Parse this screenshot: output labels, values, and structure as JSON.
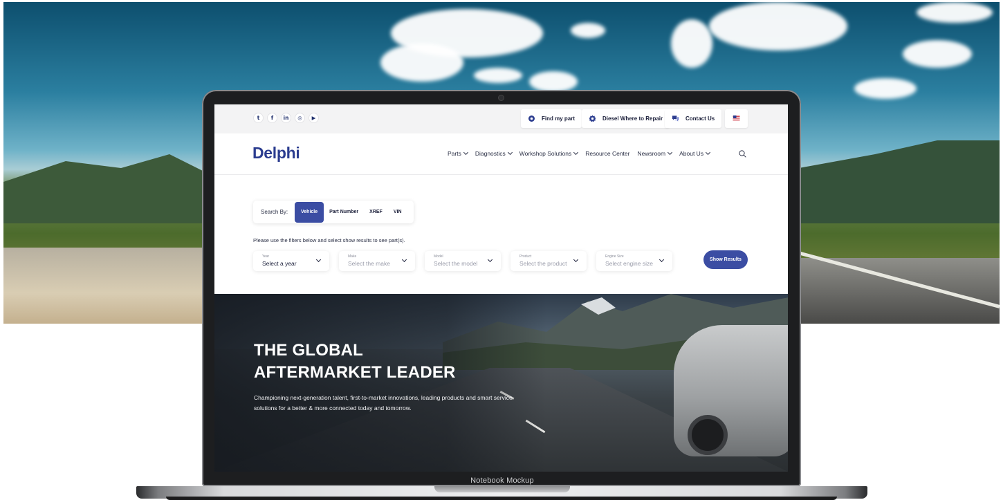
{
  "mockup": {
    "label": "Notebook Mockup"
  },
  "topbar": {
    "social": [
      {
        "icon": "twitter-icon",
        "glyph": "🐦"
      },
      {
        "icon": "facebook-icon",
        "glyph": "f"
      },
      {
        "icon": "linkedin-icon",
        "glyph": "in"
      },
      {
        "icon": "instagram-icon",
        "glyph": "◎"
      },
      {
        "icon": "youtube-icon",
        "glyph": "▶"
      }
    ],
    "find_part": "Find my part",
    "diesel_repair": "Diesel Where to Repair",
    "contact": "Contact Us",
    "language_flag": "us-flag-icon"
  },
  "brand": {
    "logo": "Delphi",
    "color": "#2b3c8f"
  },
  "nav": {
    "items": [
      "Parts",
      "Diagnostics",
      "Workshop Solutions",
      "Resource Center",
      "Newsroom",
      "About Us"
    ],
    "has_chevron": [
      true,
      true,
      true,
      false,
      true,
      true
    ]
  },
  "search": {
    "label": "Search By:",
    "options": [
      "Vehicle",
      "Part Number",
      "XREF",
      "VIN"
    ],
    "active": "Vehicle",
    "hint": "Please use the filters below and select show results to see part(s).",
    "filters": [
      {
        "label": "Year",
        "value": "Select a year"
      },
      {
        "label": "Make",
        "value": "Select the make"
      },
      {
        "label": "Model",
        "value": "Select the model"
      },
      {
        "label": "Product",
        "value": "Select the product"
      },
      {
        "label": "Engine Size",
        "value": "Select engine size"
      }
    ],
    "show_results": "Show Results",
    "accent": "#3b4da3"
  },
  "hero": {
    "title_line1": "THE GLOBAL",
    "title_line2": "AFTERMARKET LEADER",
    "text": "Championing next-generation talent, first-to-market innovations, leading products and smart service solutions for a better & more connected today and tomorrow."
  }
}
